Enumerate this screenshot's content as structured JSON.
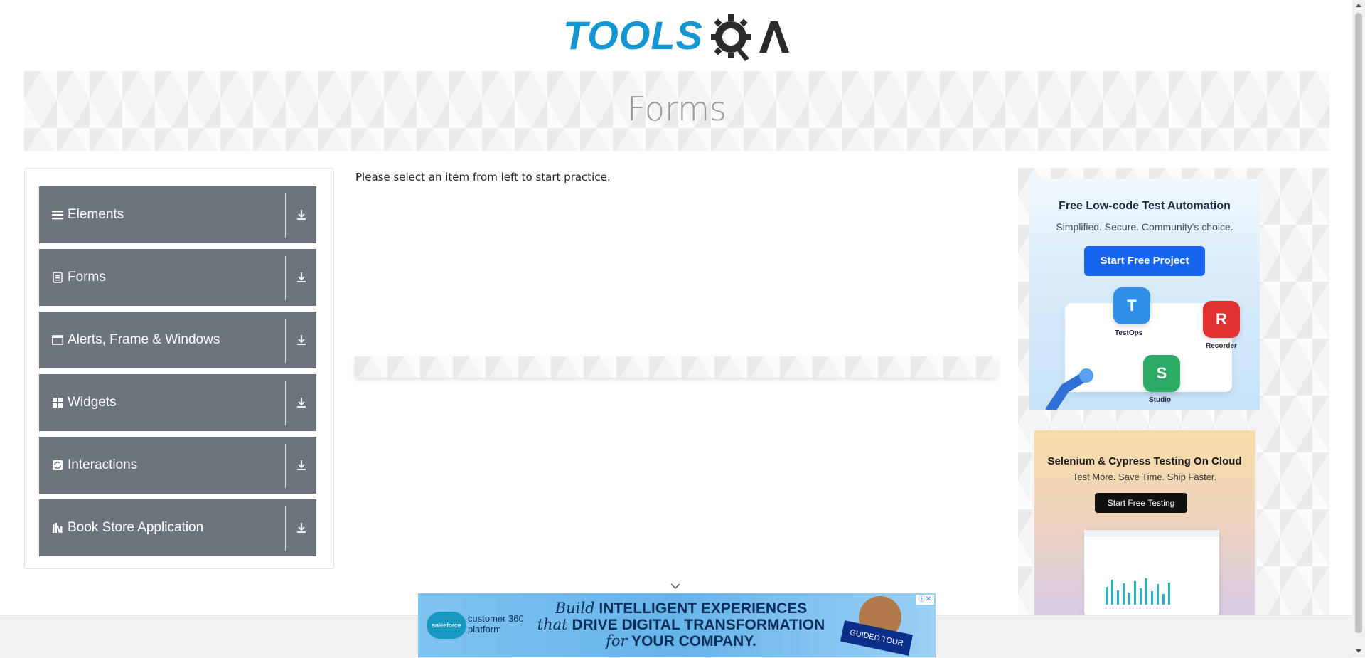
{
  "header": {
    "logo_word": "TOOLS",
    "logo_suffix": "QA"
  },
  "banner": {
    "title": "Forms"
  },
  "sidebar": {
    "groups": [
      {
        "label": "Elements",
        "icon": "menu-lines-icon"
      },
      {
        "label": "Forms",
        "icon": "document-icon"
      },
      {
        "label": "Alerts, Frame & Windows",
        "icon": "window-icon"
      },
      {
        "label": "Widgets",
        "icon": "grid-icon"
      },
      {
        "label": "Interactions",
        "icon": "cycle-icon"
      },
      {
        "label": "Book Store Application",
        "icon": "books-icon"
      }
    ]
  },
  "main": {
    "instruction": "Please select an item from left to start practice."
  },
  "ads": {
    "ad1": {
      "title": "Free Low-code Test Automation",
      "subtitle": "Simplified. Secure. Community's choice.",
      "cta": "Start Free Project",
      "apps": [
        "TestOps",
        "Recorder",
        "Studio"
      ],
      "app_letters": [
        "T",
        "R",
        "S"
      ]
    },
    "ad2": {
      "title": "Selenium & Cypress Testing On Cloud",
      "subtitle": "Test More. Save Time. Ship Faster.",
      "cta": "Start Free Testing"
    },
    "bottom": {
      "brand": "salesforce",
      "platform": "customer 360 platform",
      "line1_prefix": "Build",
      "line1": "INTELLIGENT EXPERIENCES",
      "line2_prefix": "that",
      "line2": "DRIVE DIGITAL TRANSFORMATION",
      "line3_prefix": "for",
      "line3": "YOUR COMPANY.",
      "badge": "GUIDED TOUR"
    }
  },
  "colors": {
    "brand_blue": "#1496d3",
    "sidebar_gray": "#6c757d"
  }
}
